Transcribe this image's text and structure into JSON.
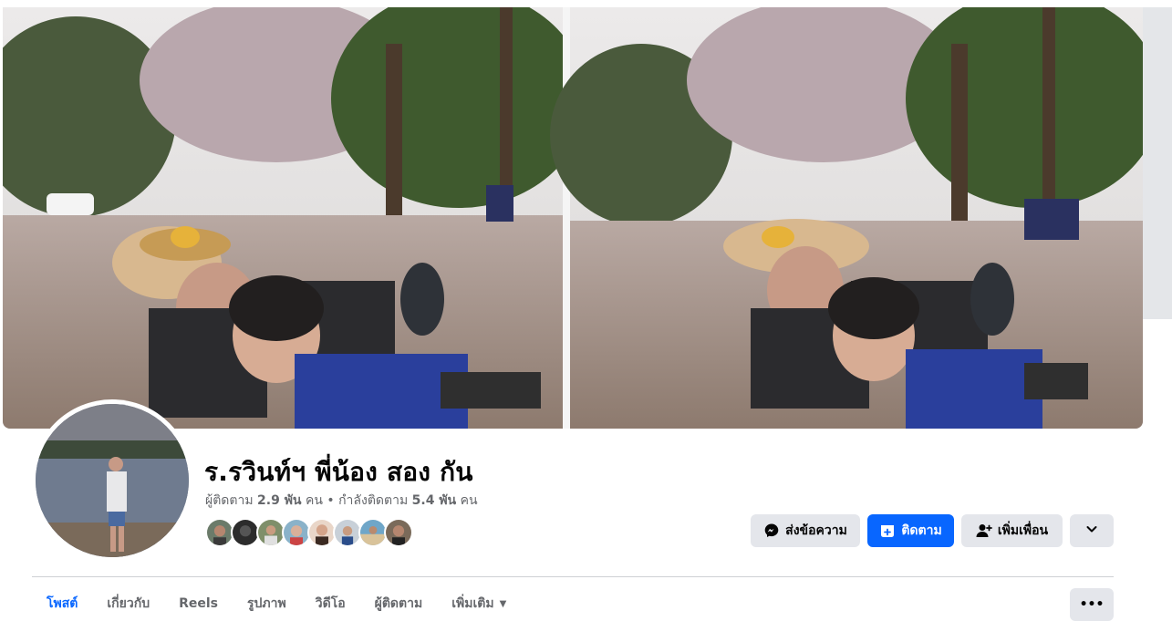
{
  "profile": {
    "name": "ร.รวินท์ฯ พี่น้อง สอง กัน",
    "followers_label": "ผู้ติดตาม",
    "followers_count": "2.9 พัน",
    "followers_unit": "คน",
    "separator": "•",
    "following_label": "กำลังติดตาม",
    "following_count": "5.4 พัน",
    "following_unit": "คน",
    "friend_avatars": [
      "friend-1",
      "friend-2",
      "friend-3",
      "friend-4",
      "friend-5",
      "friend-6",
      "friend-7",
      "friend-8"
    ]
  },
  "actions": {
    "message_label": "ส่งข้อความ",
    "follow_label": "ติดตาม",
    "add_friend_label": "เพิ่มเพื่อน",
    "more_icon": "chevron-down-icon"
  },
  "tabs": [
    {
      "label": "โพสต์",
      "active": true
    },
    {
      "label": "เกี่ยวกับ",
      "active": false
    },
    {
      "label": "Reels",
      "active": false
    },
    {
      "label": "รูปภาพ",
      "active": false
    },
    {
      "label": "วิดีโอ",
      "active": false
    },
    {
      "label": "ผู้ติดตาม",
      "active": false
    },
    {
      "label": "เพิ่มเติม",
      "active": false
    }
  ],
  "tab_more_icon": "•••",
  "colors": {
    "accent": "#0866ff",
    "button_grey": "#e4e6eb",
    "secondary_text": "#65676b"
  }
}
